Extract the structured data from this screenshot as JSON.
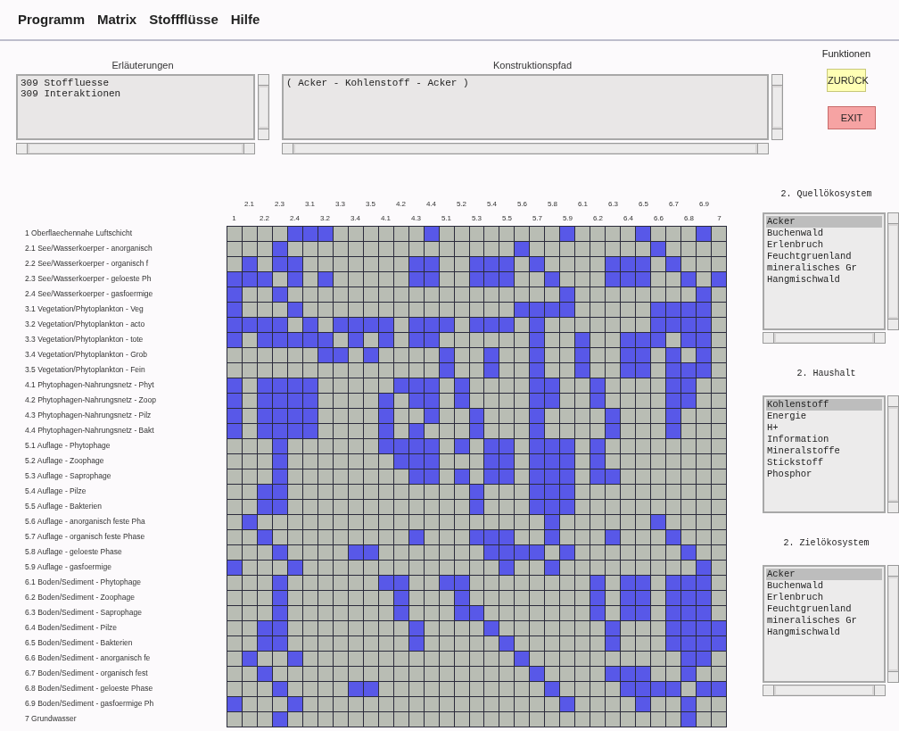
{
  "menu": [
    "Programm",
    "Matrix",
    "Stoffflüsse",
    "Hilfe"
  ],
  "explanations": {
    "title": "Erläuterungen",
    "lines": [
      "309 Stoffluesse",
      "309 Interaktionen"
    ]
  },
  "path": {
    "title": "Konstruktionspfad",
    "lines": [
      "( Acker - Kohlenstoff - Acker )"
    ]
  },
  "functions": {
    "title": "Funktionen",
    "buttons": [
      {
        "label": "ZURÜCK",
        "kind": "back"
      },
      {
        "label": "EXIT",
        "kind": "exit"
      }
    ]
  },
  "matrix": {
    "columns": [
      "1",
      "2.1",
      "2.2",
      "2.3",
      "2.4",
      "3.1",
      "3.2",
      "3.3",
      "3.4",
      "3.5",
      "4.1",
      "4.2",
      "4.3",
      "4.4",
      "5.1",
      "5.2",
      "5.3",
      "5.4",
      "5.5",
      "5.6",
      "5.7",
      "5.8",
      "5.9",
      "6.1",
      "6.2",
      "6.3",
      "6.4",
      "6.5",
      "6.6",
      "6.7",
      "6.8",
      "6.9",
      "7"
    ],
    "rows": [
      {
        "label": "1 Oberflaechennahe Luftschicht",
        "cells": [
          false,
          false,
          false,
          false,
          true,
          true,
          true,
          false,
          false,
          false,
          false,
          false,
          false,
          true,
          false,
          false,
          false,
          false,
          false,
          false,
          false,
          false,
          true,
          false,
          false,
          false,
          false,
          true,
          false,
          false,
          false,
          true,
          false
        ]
      },
      {
        "label": "2.1 See/Wasserkoerper - anorganisch",
        "cells": [
          false,
          false,
          false,
          true,
          false,
          false,
          false,
          false,
          false,
          false,
          false,
          false,
          false,
          false,
          false,
          false,
          false,
          false,
          false,
          true,
          false,
          false,
          false,
          false,
          false,
          false,
          false,
          false,
          true,
          false,
          false,
          false,
          false
        ]
      },
      {
        "label": "2.2 See/Wasserkoerper - organisch f",
        "cells": [
          false,
          true,
          false,
          true,
          true,
          false,
          false,
          false,
          false,
          false,
          false,
          false,
          true,
          true,
          false,
          false,
          true,
          true,
          true,
          false,
          true,
          false,
          false,
          false,
          false,
          true,
          true,
          true,
          false,
          true,
          false,
          false,
          false
        ]
      },
      {
        "label": "2.3 See/Wasserkoerper - geloeste Ph",
        "cells": [
          true,
          true,
          true,
          false,
          true,
          false,
          true,
          false,
          false,
          false,
          false,
          false,
          true,
          true,
          false,
          false,
          true,
          true,
          true,
          false,
          false,
          true,
          false,
          false,
          false,
          true,
          true,
          true,
          false,
          false,
          true,
          false,
          true
        ]
      },
      {
        "label": "2.4 See/Wasserkoerper - gasfoermige",
        "cells": [
          true,
          false,
          false,
          true,
          false,
          false,
          false,
          false,
          false,
          false,
          false,
          false,
          false,
          false,
          false,
          false,
          false,
          false,
          false,
          false,
          false,
          false,
          true,
          false,
          false,
          false,
          false,
          false,
          false,
          false,
          false,
          true,
          false
        ]
      },
      {
        "label": "3.1 Vegetation/Phytoplankton - Veg",
        "cells": [
          true,
          false,
          false,
          false,
          true,
          false,
          false,
          false,
          false,
          false,
          false,
          false,
          false,
          false,
          false,
          false,
          false,
          false,
          false,
          true,
          true,
          true,
          true,
          false,
          false,
          false,
          false,
          false,
          true,
          true,
          true,
          true,
          false
        ]
      },
      {
        "label": "3.2 Vegetation/Phytoplankton - acto",
        "cells": [
          true,
          true,
          true,
          true,
          false,
          true,
          false,
          true,
          true,
          true,
          true,
          false,
          true,
          true,
          true,
          false,
          true,
          true,
          true,
          false,
          true,
          false,
          false,
          false,
          false,
          false,
          false,
          false,
          true,
          true,
          true,
          true,
          false
        ]
      },
      {
        "label": "3.3 Vegetation/Phytoplankton - tote",
        "cells": [
          true,
          false,
          true,
          true,
          true,
          true,
          true,
          false,
          true,
          false,
          true,
          false,
          true,
          true,
          false,
          false,
          false,
          false,
          false,
          false,
          true,
          false,
          false,
          true,
          false,
          false,
          true,
          true,
          true,
          false,
          true,
          true,
          false
        ]
      },
      {
        "label": "3.4 Vegetation/Phytoplankton - Grob",
        "cells": [
          false,
          false,
          false,
          false,
          false,
          false,
          true,
          true,
          false,
          true,
          false,
          false,
          false,
          false,
          true,
          false,
          false,
          true,
          false,
          false,
          true,
          false,
          false,
          true,
          false,
          false,
          true,
          true,
          false,
          true,
          false,
          true,
          false
        ]
      },
      {
        "label": "3.5 Vegetation/Phytoplankton - Fein",
        "cells": [
          false,
          false,
          false,
          false,
          false,
          false,
          false,
          false,
          false,
          false,
          false,
          false,
          false,
          false,
          true,
          false,
          false,
          true,
          false,
          false,
          true,
          false,
          false,
          true,
          false,
          false,
          true,
          true,
          false,
          true,
          true,
          true,
          false
        ]
      },
      {
        "label": "4.1 Phytophagen-Nahrungsnetz - Phyt",
        "cells": [
          true,
          false,
          true,
          true,
          true,
          true,
          false,
          false,
          false,
          false,
          false,
          true,
          true,
          true,
          false,
          true,
          false,
          false,
          false,
          false,
          true,
          true,
          false,
          false,
          true,
          false,
          false,
          false,
          false,
          true,
          true,
          false,
          false
        ]
      },
      {
        "label": "4.2 Phytophagen-Nahrungsnetz - Zoop",
        "cells": [
          true,
          false,
          true,
          true,
          true,
          true,
          false,
          false,
          false,
          false,
          true,
          false,
          true,
          true,
          false,
          true,
          false,
          false,
          false,
          false,
          true,
          true,
          false,
          false,
          true,
          false,
          false,
          false,
          false,
          true,
          true,
          false,
          false
        ]
      },
      {
        "label": "4.3 Phytophagen-Nahrungsnetz - Pilz",
        "cells": [
          true,
          false,
          true,
          true,
          true,
          true,
          false,
          false,
          false,
          false,
          true,
          false,
          false,
          true,
          false,
          false,
          true,
          false,
          false,
          false,
          true,
          false,
          false,
          false,
          false,
          true,
          false,
          false,
          false,
          true,
          false,
          false,
          false
        ]
      },
      {
        "label": "4.4 Phytophagen-Nahrungsnetz - Bakt",
        "cells": [
          true,
          false,
          true,
          true,
          true,
          true,
          false,
          false,
          false,
          false,
          true,
          false,
          true,
          false,
          false,
          false,
          true,
          false,
          false,
          false,
          true,
          false,
          false,
          false,
          false,
          true,
          false,
          false,
          false,
          true,
          false,
          false,
          false
        ]
      },
      {
        "label": "5.1 Auflage - Phytophage",
        "cells": [
          false,
          false,
          false,
          true,
          false,
          false,
          false,
          false,
          false,
          false,
          true,
          true,
          true,
          true,
          false,
          true,
          false,
          true,
          true,
          false,
          true,
          true,
          true,
          false,
          true,
          false,
          false,
          false,
          false,
          false,
          false,
          false,
          false
        ]
      },
      {
        "label": "5.2 Auflage - Zoophage",
        "cells": [
          false,
          false,
          false,
          true,
          false,
          false,
          false,
          false,
          false,
          false,
          false,
          true,
          true,
          true,
          false,
          false,
          false,
          true,
          true,
          false,
          true,
          true,
          true,
          false,
          true,
          false,
          false,
          false,
          false,
          false,
          false,
          false,
          false
        ]
      },
      {
        "label": "5.3 Auflage - Saprophage",
        "cells": [
          false,
          false,
          false,
          true,
          false,
          false,
          false,
          false,
          false,
          false,
          false,
          false,
          true,
          true,
          false,
          true,
          false,
          true,
          true,
          false,
          true,
          true,
          true,
          false,
          true,
          true,
          false,
          false,
          false,
          false,
          false,
          false,
          false
        ]
      },
      {
        "label": "5.4 Auflage - Pilze",
        "cells": [
          false,
          false,
          true,
          true,
          false,
          false,
          false,
          false,
          false,
          false,
          false,
          false,
          false,
          false,
          false,
          false,
          true,
          false,
          false,
          false,
          true,
          true,
          true,
          false,
          false,
          false,
          false,
          false,
          false,
          false,
          false,
          false,
          false
        ]
      },
      {
        "label": "5.5 Auflage - Bakterien",
        "cells": [
          false,
          false,
          true,
          true,
          false,
          false,
          false,
          false,
          false,
          false,
          false,
          false,
          false,
          false,
          false,
          false,
          true,
          false,
          false,
          false,
          true,
          true,
          true,
          false,
          false,
          false,
          false,
          false,
          false,
          false,
          false,
          false,
          false
        ]
      },
      {
        "label": "5.6 Auflage - anorganisch feste Pha",
        "cells": [
          false,
          true,
          false,
          false,
          false,
          false,
          false,
          false,
          false,
          false,
          false,
          false,
          false,
          false,
          false,
          false,
          false,
          false,
          false,
          false,
          false,
          true,
          false,
          false,
          false,
          false,
          false,
          false,
          true,
          false,
          false,
          false,
          false
        ]
      },
      {
        "label": "5.7 Auflage - organisch feste Phase",
        "cells": [
          false,
          false,
          true,
          false,
          false,
          false,
          false,
          false,
          false,
          false,
          false,
          false,
          true,
          false,
          false,
          false,
          true,
          true,
          true,
          false,
          false,
          true,
          false,
          false,
          false,
          true,
          false,
          false,
          false,
          true,
          false,
          false,
          false
        ]
      },
      {
        "label": "5.8 Auflage - geloeste Phase",
        "cells": [
          false,
          false,
          false,
          true,
          false,
          false,
          false,
          false,
          true,
          true,
          false,
          false,
          false,
          false,
          false,
          false,
          false,
          true,
          true,
          true,
          true,
          false,
          true,
          false,
          false,
          false,
          false,
          false,
          false,
          false,
          true,
          false,
          false
        ]
      },
      {
        "label": "5.9 Auflage - gasfoermige",
        "cells": [
          true,
          false,
          false,
          false,
          true,
          false,
          false,
          false,
          false,
          false,
          false,
          false,
          false,
          false,
          false,
          false,
          false,
          false,
          true,
          false,
          false,
          true,
          false,
          false,
          false,
          false,
          false,
          false,
          false,
          false,
          false,
          true,
          false
        ]
      },
      {
        "label": "6.1 Boden/Sediment - Phytophage",
        "cells": [
          false,
          false,
          false,
          true,
          false,
          false,
          false,
          false,
          false,
          false,
          true,
          true,
          false,
          false,
          true,
          true,
          false,
          false,
          false,
          false,
          false,
          false,
          false,
          false,
          true,
          false,
          true,
          true,
          false,
          true,
          true,
          true,
          false
        ]
      },
      {
        "label": "6.2 Boden/Sediment - Zoophage",
        "cells": [
          false,
          false,
          false,
          true,
          false,
          false,
          false,
          false,
          false,
          false,
          false,
          true,
          false,
          false,
          false,
          true,
          false,
          false,
          false,
          false,
          false,
          false,
          false,
          false,
          true,
          false,
          true,
          true,
          false,
          true,
          true,
          true,
          false
        ]
      },
      {
        "label": "6.3 Boden/Sediment - Saprophage",
        "cells": [
          false,
          false,
          false,
          true,
          false,
          false,
          false,
          false,
          false,
          false,
          false,
          true,
          false,
          false,
          false,
          true,
          true,
          false,
          false,
          false,
          false,
          false,
          false,
          false,
          true,
          false,
          true,
          true,
          false,
          true,
          true,
          true,
          false
        ]
      },
      {
        "label": "6.4 Boden/Sediment - Pilze",
        "cells": [
          false,
          false,
          true,
          true,
          false,
          false,
          false,
          false,
          false,
          false,
          false,
          false,
          true,
          false,
          false,
          false,
          false,
          true,
          false,
          false,
          false,
          false,
          false,
          false,
          false,
          true,
          false,
          false,
          false,
          true,
          true,
          true,
          true
        ]
      },
      {
        "label": "6.5 Boden/Sediment - Bakterien",
        "cells": [
          false,
          false,
          true,
          true,
          false,
          false,
          false,
          false,
          false,
          false,
          false,
          false,
          true,
          false,
          false,
          false,
          false,
          false,
          true,
          false,
          false,
          false,
          false,
          false,
          false,
          true,
          false,
          false,
          false,
          true,
          true,
          true,
          true
        ]
      },
      {
        "label": "6.6 Boden/Sediment - anorganisch fe",
        "cells": [
          false,
          true,
          false,
          false,
          true,
          false,
          false,
          false,
          false,
          false,
          false,
          false,
          false,
          false,
          false,
          false,
          false,
          false,
          false,
          true,
          false,
          false,
          false,
          false,
          false,
          false,
          false,
          false,
          false,
          false,
          true,
          true,
          false
        ]
      },
      {
        "label": "6.7 Boden/Sediment - organisch fest",
        "cells": [
          false,
          false,
          true,
          false,
          false,
          false,
          false,
          false,
          false,
          false,
          false,
          false,
          false,
          false,
          false,
          false,
          false,
          false,
          false,
          false,
          true,
          false,
          false,
          false,
          false,
          true,
          true,
          true,
          false,
          false,
          true,
          false,
          false
        ]
      },
      {
        "label": "6.8 Boden/Sediment - geloeste Phase",
        "cells": [
          false,
          false,
          false,
          true,
          false,
          false,
          false,
          false,
          true,
          true,
          false,
          false,
          false,
          false,
          false,
          false,
          false,
          false,
          false,
          false,
          false,
          true,
          false,
          false,
          false,
          false,
          true,
          true,
          true,
          true,
          false,
          true,
          true
        ]
      },
      {
        "label": "6.9 Boden/Sediment - gasfoermige Ph",
        "cells": [
          true,
          false,
          false,
          false,
          true,
          false,
          false,
          false,
          false,
          false,
          false,
          false,
          false,
          false,
          false,
          false,
          false,
          false,
          false,
          false,
          false,
          false,
          true,
          false,
          false,
          false,
          false,
          true,
          false,
          false,
          true,
          false,
          false
        ]
      },
      {
        "label": "7 Grundwasser",
        "cells": [
          false,
          false,
          false,
          true,
          false,
          false,
          false,
          false,
          false,
          false,
          false,
          false,
          false,
          false,
          false,
          false,
          false,
          false,
          false,
          false,
          false,
          false,
          false,
          false,
          false,
          false,
          false,
          false,
          false,
          false,
          true,
          false,
          false
        ]
      }
    ]
  },
  "lists": [
    {
      "title": "2. Quellökosystem",
      "horizontal_scrollbar": true,
      "items": [
        {
          "label": "Acker",
          "selected": true
        },
        {
          "label": "Buchenwald",
          "selected": false
        },
        {
          "label": "Erlenbruch",
          "selected": false
        },
        {
          "label": "Feuchtgruenland",
          "selected": false
        },
        {
          "label": "mineralisches Gr",
          "selected": false
        },
        {
          "label": "Hangmischwald",
          "selected": false
        }
      ]
    },
    {
      "title": "2. Haushalt",
      "horizontal_scrollbar": false,
      "items": [
        {
          "label": "Kohlenstoff",
          "selected": true
        },
        {
          "label": "Energie",
          "selected": false
        },
        {
          "label": "H+",
          "selected": false
        },
        {
          "label": "Information",
          "selected": false
        },
        {
          "label": "Mineralstoffe",
          "selected": false
        },
        {
          "label": "Stickstoff",
          "selected": false
        },
        {
          "label": "Phosphor",
          "selected": false
        }
      ]
    },
    {
      "title": "2. Zielökosystem",
      "horizontal_scrollbar": true,
      "items": [
        {
          "label": "Acker",
          "selected": true
        },
        {
          "label": "Buchenwald",
          "selected": false
        },
        {
          "label": "Erlenbruch",
          "selected": false
        },
        {
          "label": "Feuchtgruenland",
          "selected": false
        },
        {
          "label": "mineralisches Gr",
          "selected": false
        },
        {
          "label": "Hangmischwald",
          "selected": false
        }
      ]
    }
  ]
}
